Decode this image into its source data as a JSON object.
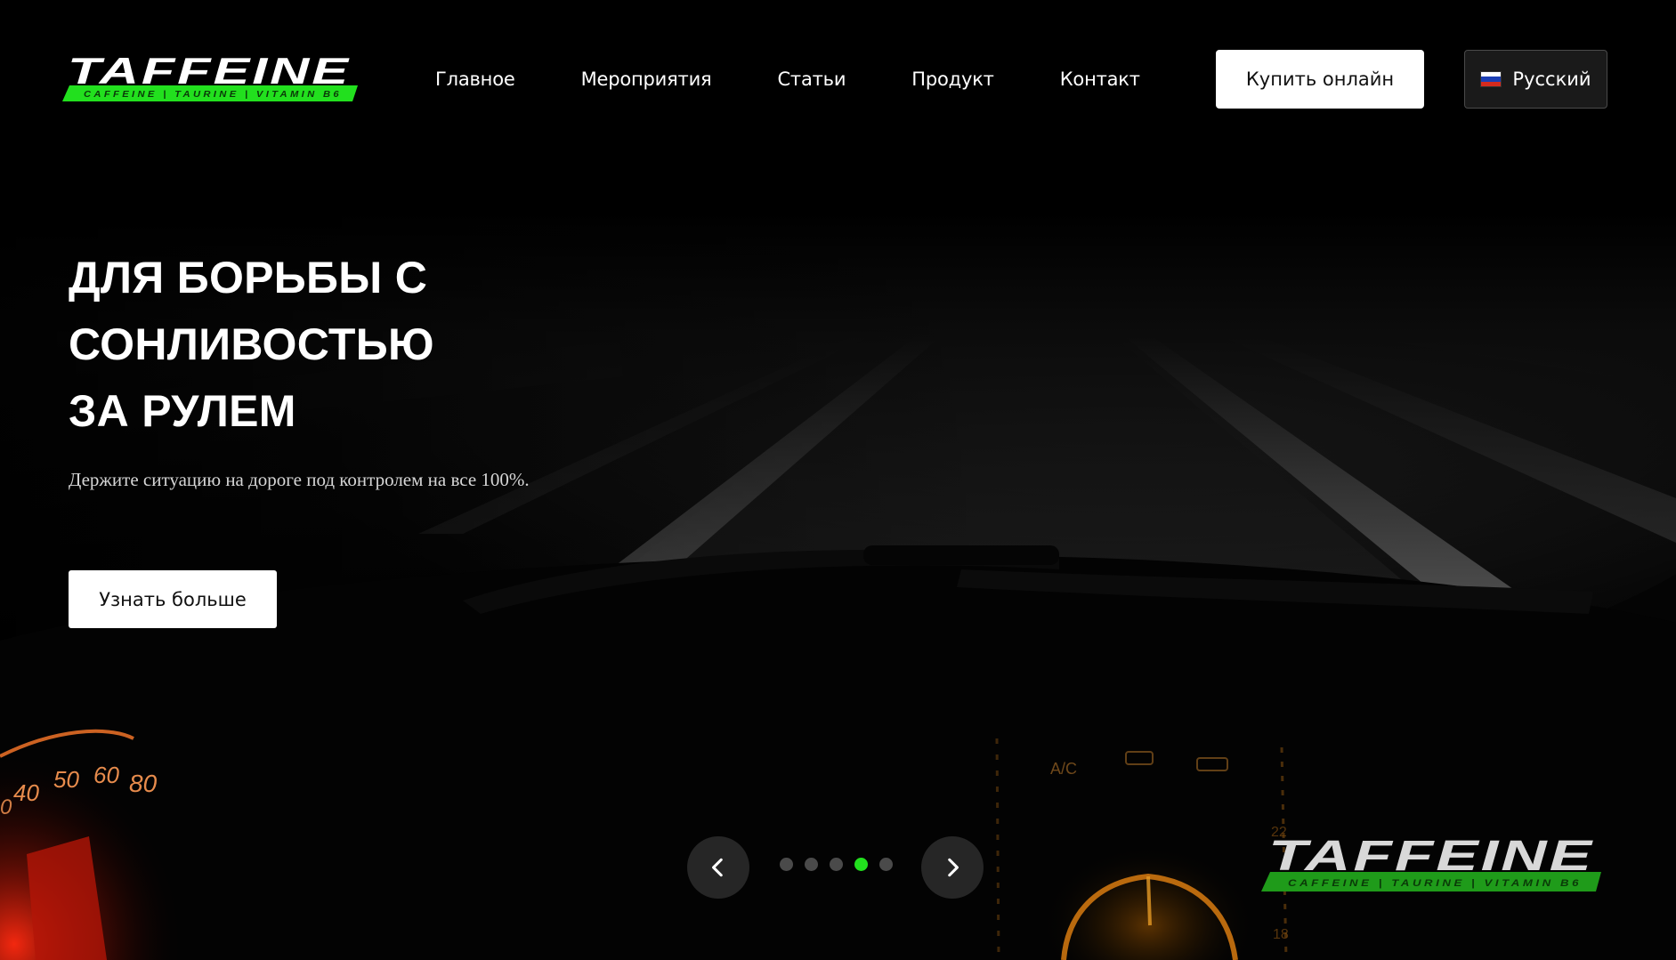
{
  "brand": {
    "name": "TAFFEINE",
    "tagline": "CAFFEINE | TAURINE | VITAMIN B6",
    "accent_color": "#22e01e"
  },
  "nav": {
    "items": [
      {
        "label": "Главное"
      },
      {
        "label": "Мероприятия"
      },
      {
        "label": "Статьи"
      },
      {
        "label": "Продукт"
      },
      {
        "label": "Контакт"
      }
    ]
  },
  "header": {
    "buy_label": "Купить онлайн",
    "language_label": "Русский",
    "language_flag_icon": "russia-flag-icon"
  },
  "hero": {
    "title_lines": [
      "ДЛЯ БОРЬБЫ С",
      "СОНЛИВОСТЬЮ",
      "ЗА РУЛЕМ"
    ],
    "subtitle": "Держите ситуацию на дороге под контролем на все 100%.",
    "cta_label": "Узнать больше"
  },
  "slider": {
    "slide_count": 5,
    "active_index": 3,
    "prev_icon": "chevron-left-icon",
    "next_icon": "chevron-right-icon"
  },
  "dashboard_labels": {
    "speedo_ticks": [
      "0",
      "40",
      "50",
      "60",
      "80"
    ],
    "ac_label": "A/C",
    "gauge_marks": [
      "22",
      "18"
    ]
  }
}
